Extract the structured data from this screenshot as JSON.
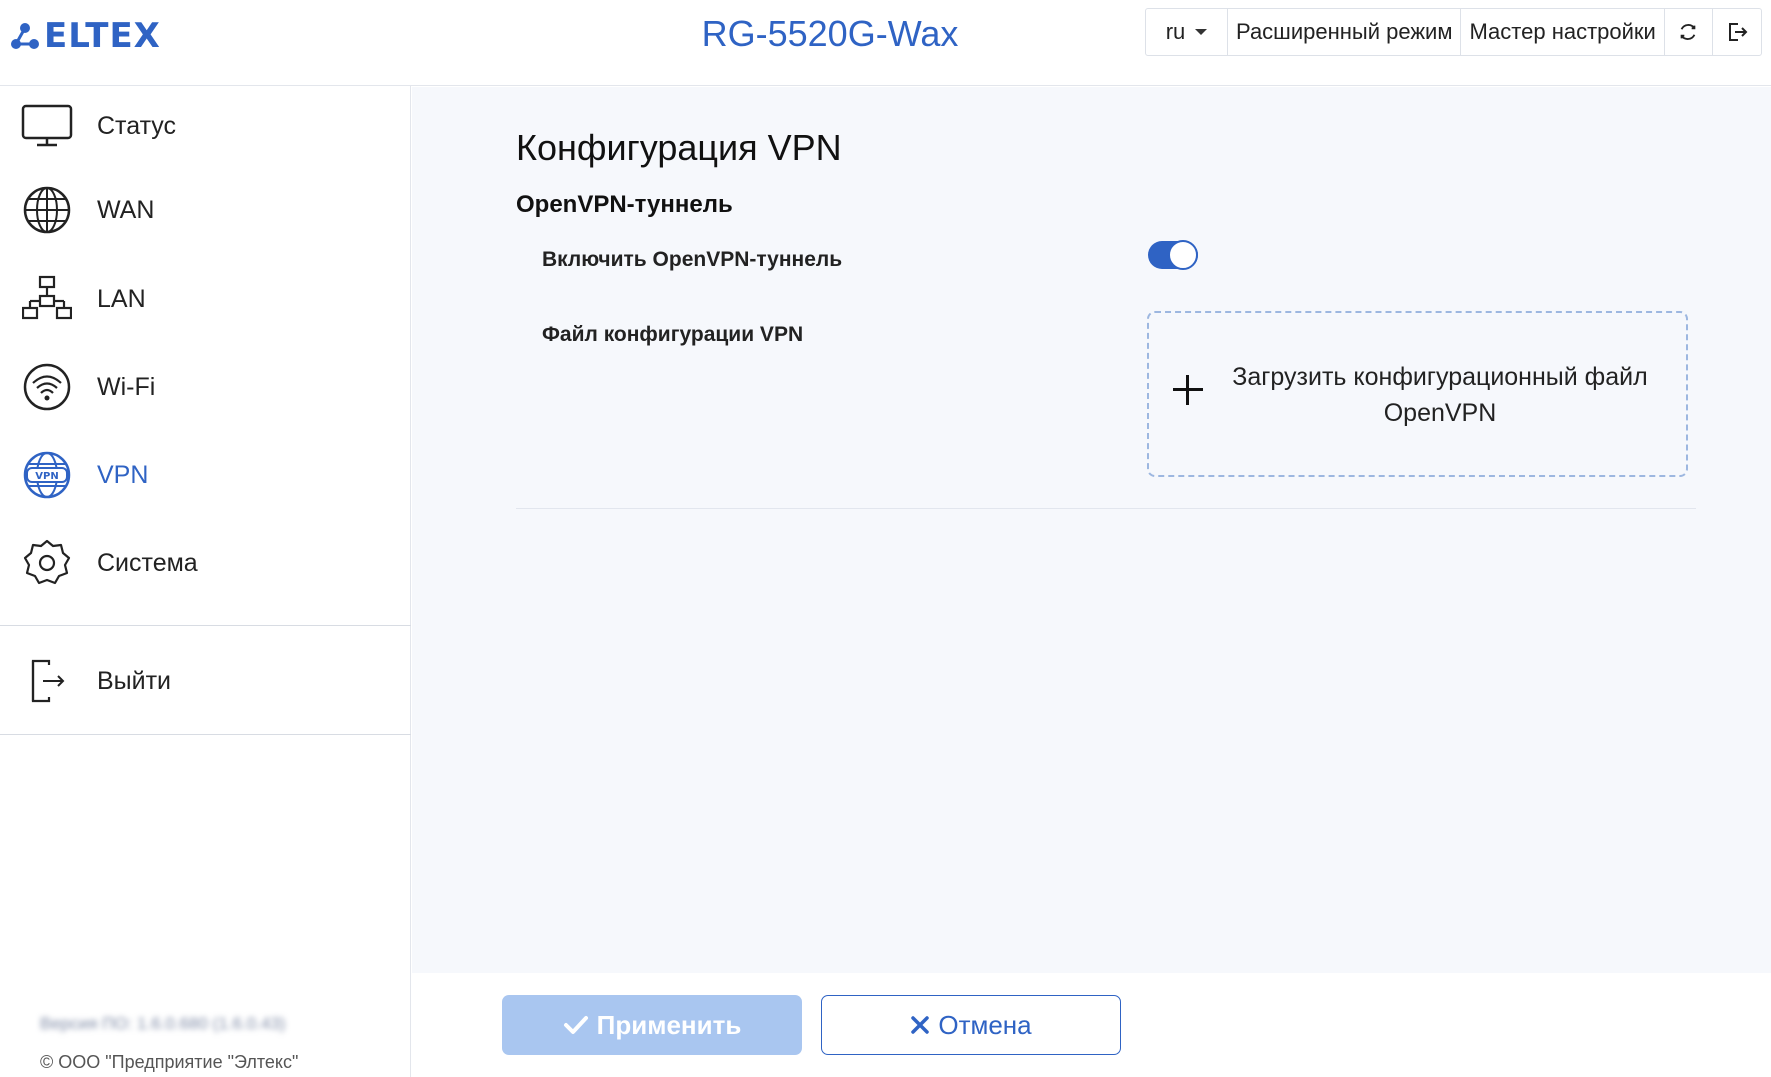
{
  "header": {
    "logo_text": "ELTEX",
    "device_title": "RG-5520G-Wax",
    "lang": "ru",
    "advanced_mode": "Расширенный режим",
    "setup_wizard": "Мастер настройки",
    "icons": [
      "refresh-icon",
      "logout-icon"
    ]
  },
  "sidebar": {
    "items": [
      {
        "label": "Статус",
        "icon": "monitor-icon"
      },
      {
        "label": "WAN",
        "icon": "globe-icon"
      },
      {
        "label": "LAN",
        "icon": "network-icon"
      },
      {
        "label": "Wi-Fi",
        "icon": "wifi-icon"
      },
      {
        "label": "VPN",
        "icon": "vpn-globe-icon",
        "active": true
      },
      {
        "label": "Система",
        "icon": "gear-icon"
      }
    ],
    "logout_label": "Выйти",
    "version": "Версия ПО: 1.6.0.680 (1.6.0.43)",
    "copyright": "© ООО \"Предприятие \"Элтекс\""
  },
  "main": {
    "title": "Конфигурация VPN",
    "section_title": "OpenVPN-туннель",
    "enable_label": "Включить OpenVPN-туннель",
    "enabled": true,
    "config_file_label": "Файл конфигурации VPN",
    "upload_line1": "Загрузить конфигурационный файл",
    "upload_line2": "OpenVPN"
  },
  "footer": {
    "apply_label": "Применить",
    "cancel_label": "Отмена"
  },
  "colors": {
    "accent": "#2f63c4",
    "apply_disabled": "#a9c6f0",
    "main_bg": "#f6f8fc"
  }
}
